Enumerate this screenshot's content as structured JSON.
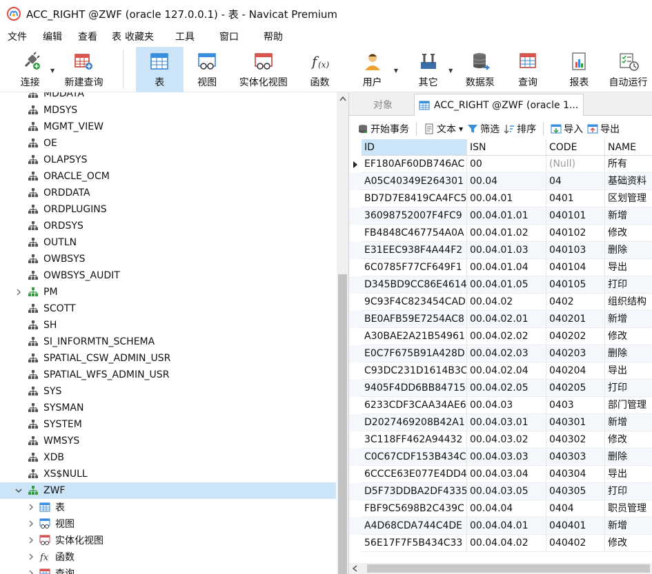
{
  "window": {
    "title": "ACC_RIGHT @ZWF (oracle 127.0.0.1) - 表 - Navicat Premium"
  },
  "menu": [
    "文件",
    "编辑",
    "查看",
    "表",
    "收藏夹",
    "工具",
    "窗口",
    "帮助"
  ],
  "toolbar": {
    "connect": "连接",
    "new_query": "新建查询",
    "table": "表",
    "view": "视图",
    "materialized_view": "实体化视图",
    "function": "函数",
    "user": "用户",
    "other": "其它",
    "data_pump": "数据泵",
    "query": "查询",
    "report": "报表",
    "auto_run": "自动运行"
  },
  "tree": {
    "items": [
      {
        "label": "MDDATA"
      },
      {
        "label": "MDSYS"
      },
      {
        "label": "MGMT_VIEW"
      },
      {
        "label": "OE"
      },
      {
        "label": "OLAPSYS"
      },
      {
        "label": "ORACLE_OCM"
      },
      {
        "label": "ORDDATA"
      },
      {
        "label": "ORDPLUGINS"
      },
      {
        "label": "ORDSYS"
      },
      {
        "label": "OUTLN"
      },
      {
        "label": "OWBSYS"
      },
      {
        "label": "OWBSYS_AUDIT"
      },
      {
        "label": "PM"
      },
      {
        "label": "SCOTT"
      },
      {
        "label": "SH"
      },
      {
        "label": "SI_INFORMTN_SCHEMA"
      },
      {
        "label": "SPATIAL_CSW_ADMIN_USR"
      },
      {
        "label": "SPATIAL_WFS_ADMIN_USR"
      },
      {
        "label": "SYS"
      },
      {
        "label": "SYSMAN"
      },
      {
        "label": "SYSTEM"
      },
      {
        "label": "WMSYS"
      },
      {
        "label": "XDB"
      },
      {
        "label": "XS$NULL"
      },
      {
        "label": "ZWF"
      }
    ],
    "children": [
      {
        "label": "表"
      },
      {
        "label": "视图"
      },
      {
        "label": "实体化视图"
      },
      {
        "label": "函数"
      },
      {
        "label": "查询"
      }
    ]
  },
  "tabs": {
    "objects": "对象",
    "active": "ACC_RIGHT @ZWF (oracle 1..."
  },
  "subtoolbar": {
    "begin_transaction": "开始事务",
    "text": "文本",
    "filter": "筛选",
    "sort": "排序",
    "import": "导入",
    "export": "导出"
  },
  "grid": {
    "columns": [
      "ID",
      "ISN",
      "CODE",
      "NAME"
    ],
    "rows": [
      [
        "EF180AF60DB746AC",
        "00",
        "(Null)",
        "所有"
      ],
      [
        "A05C40349E264301",
        "00.04",
        "04",
        "基础资料"
      ],
      [
        "BD7D7E8419CA4FC5",
        "00.04.01",
        "0401",
        "区划管理"
      ],
      [
        "36098752007F4FC9",
        "00.04.01.01",
        "040101",
        "新增"
      ],
      [
        "FB4848C467754A0A",
        "00.04.01.02",
        "040102",
        "修改"
      ],
      [
        "E31EEC938F4A44F2",
        "00.04.01.03",
        "040103",
        "删除"
      ],
      [
        "6C0785F77CF649F1",
        "00.04.01.04",
        "040104",
        "导出"
      ],
      [
        "D345BD9CC86E4614",
        "00.04.01.05",
        "040105",
        "打印"
      ],
      [
        "9C93F4C823454CAD",
        "00.04.02",
        "0402",
        "组织结构"
      ],
      [
        "BE0AFB59E7254AC8",
        "00.04.02.01",
        "040201",
        "新增"
      ],
      [
        "A30BAE2A21B54961",
        "00.04.02.02",
        "040202",
        "修改"
      ],
      [
        "E0C7F675B91A428D",
        "00.04.02.03",
        "040203",
        "删除"
      ],
      [
        "C93DC231D1614B3C",
        "00.04.02.04",
        "040204",
        "导出"
      ],
      [
        "9405F4DD6BB84715",
        "00.04.02.05",
        "040205",
        "打印"
      ],
      [
        "6233CDF3CAA34AE6",
        "00.04.03",
        "0403",
        "部门管理"
      ],
      [
        "D2027469208B42A1",
        "00.04.03.01",
        "040301",
        "新增"
      ],
      [
        "3C118FF462A94432",
        "00.04.03.02",
        "040302",
        "修改"
      ],
      [
        "C0C67CDF153B434C",
        "00.04.03.03",
        "040303",
        "删除"
      ],
      [
        "6CCCE63E077E4DD4",
        "00.04.03.04",
        "040304",
        "导出"
      ],
      [
        "D5F73DDBA2DF4335",
        "00.04.03.05",
        "040305",
        "打印"
      ],
      [
        "FBF9C5698B2C439C",
        "00.04.04",
        "0404",
        "职员管理"
      ],
      [
        "A4D68CDA744C4DE",
        "00.04.04.01",
        "040401",
        "新增"
      ],
      [
        "56E17F7F5B434C33",
        "00.04.04.02",
        "040402",
        "修改"
      ]
    ]
  },
  "colors": {
    "selection": "#cce4f7",
    "schema_icon": "#555555",
    "schema_icon_open": "#2e9e3a",
    "table_icon": "#2f7fcf"
  }
}
